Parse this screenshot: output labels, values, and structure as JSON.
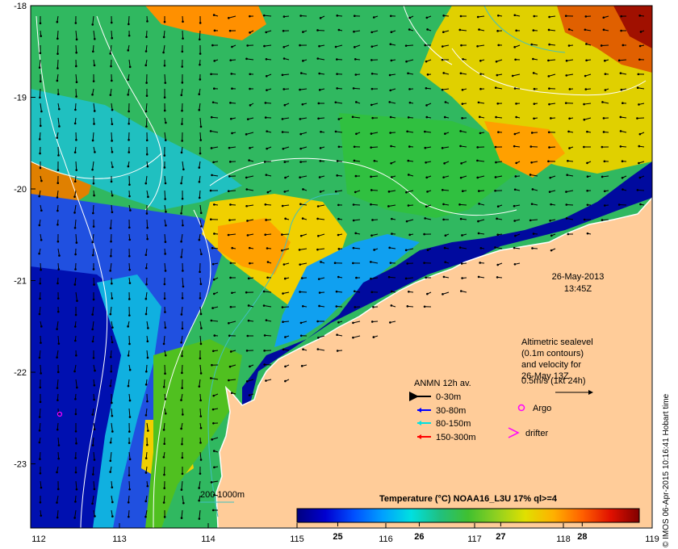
{
  "chart_data": {
    "type": "heatmap",
    "title": "",
    "x_ticks": [
      "112",
      "113",
      "114",
      "115",
      "116",
      "117",
      "118",
      "119"
    ],
    "y_ticks": [
      "-18",
      "-19",
      "-20",
      "-21",
      "-22",
      "-23"
    ],
    "xlim": [
      112,
      119
    ],
    "ylim": [
      -23.7,
      -18
    ],
    "colorbar": {
      "title": "Temperature (°C) NOAA16_L3U 17% ql>=4",
      "ticks": [
        "25",
        "26",
        "27",
        "28"
      ],
      "range": [
        24.5,
        28.7
      ],
      "colors": [
        "#00007f",
        "#0000d0",
        "#0050ff",
        "#00a0ff",
        "#00e0e0",
        "#20c080",
        "#40c030",
        "#90d020",
        "#e0e000",
        "#ffb000",
        "#ff6000",
        "#e01000",
        "#800000"
      ]
    },
    "date_label": "26-May-2013",
    "time_label": "13:45Z",
    "annotation_lines": [
      "Altimetric sealevel",
      "(0.1m contours)",
      "and velocity for",
      "26-May 13Z",
      "0.5m/s (1kt 24h)"
    ],
    "legend": {
      "title": "ANMN 12h av.",
      "items": [
        {
          "label": "0-30m",
          "color": "#000000"
        },
        {
          "label": "30-80m",
          "color": "#0000ff"
        },
        {
          "label": "80-150m",
          "color": "#00e0e0"
        },
        {
          "label": "150-300m",
          "color": "#ff0000"
        }
      ],
      "argo_label": "Argo",
      "drifter_label": "drifter",
      "marker_color": "#ff00ff"
    },
    "isobath_label": "200  1000m",
    "credit": "© IMOS 06-Apr-2015 10:16:41 Hobart time",
    "land_color": "#ffcc99"
  }
}
